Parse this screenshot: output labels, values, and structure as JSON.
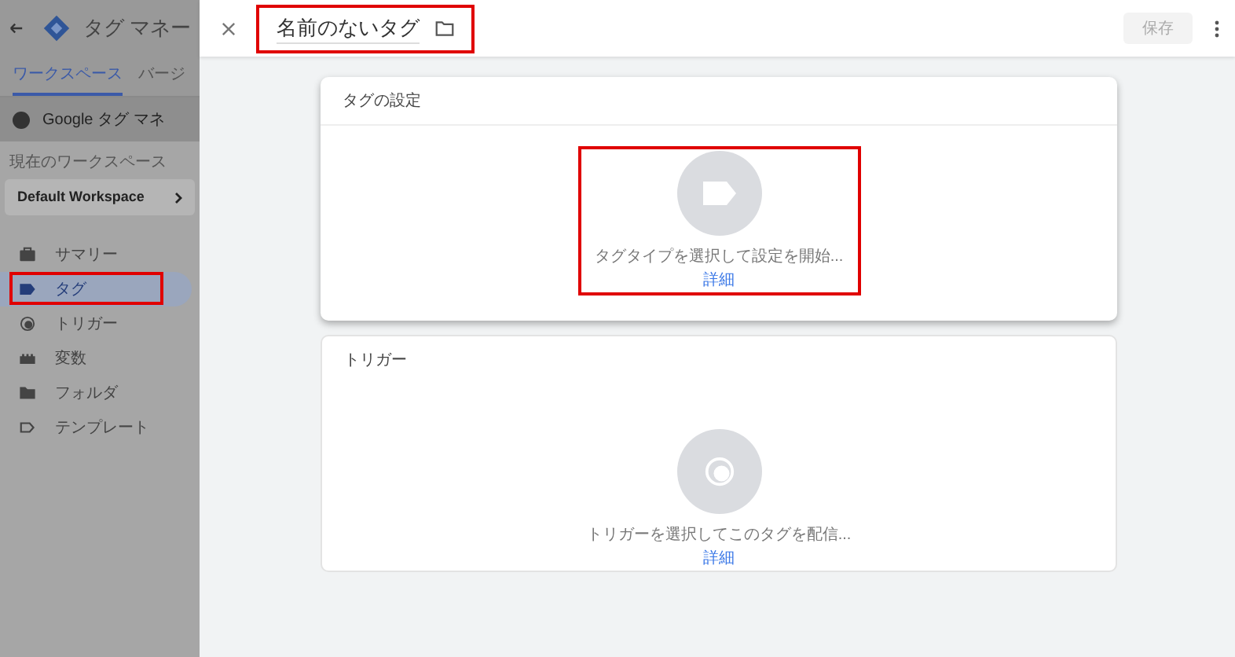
{
  "app": {
    "title": "タグ マネー",
    "tabs": [
      {
        "label": "ワークスペース",
        "selected": true
      },
      {
        "label": "バージ",
        "selected": false
      }
    ],
    "notice": "Google タグ マネ",
    "workspace_label": "現在のワークスペース",
    "workspace": "Default Workspace",
    "nav": [
      {
        "label": "サマリー",
        "kind": "summary",
        "selected": false,
        "highlighted": false
      },
      {
        "label": "タグ",
        "kind": "tag",
        "selected": true,
        "highlighted": true
      },
      {
        "label": "トリガー",
        "kind": "trigger",
        "selected": false,
        "highlighted": false
      },
      {
        "label": "変数",
        "kind": "variable",
        "selected": false,
        "highlighted": false
      },
      {
        "label": "フォルダ",
        "kind": "folder",
        "selected": false,
        "highlighted": false
      },
      {
        "label": "テンプレート",
        "kind": "template",
        "selected": false,
        "highlighted": false
      }
    ]
  },
  "panel": {
    "title": "名前のないタグ",
    "title_highlighted": true,
    "save": "保存",
    "save_disabled": true,
    "cards": [
      {
        "title": "タグの設定",
        "kind": "tag",
        "prompt": "タグタイプを選択して設定を開始...",
        "link": "詳細",
        "highlighted": true,
        "raised": true
      },
      {
        "title": "トリガー",
        "kind": "trigger",
        "prompt": "トリガーを選択してこのタグを配信...",
        "link": "詳細",
        "highlighted": false,
        "raised": false
      }
    ]
  }
}
